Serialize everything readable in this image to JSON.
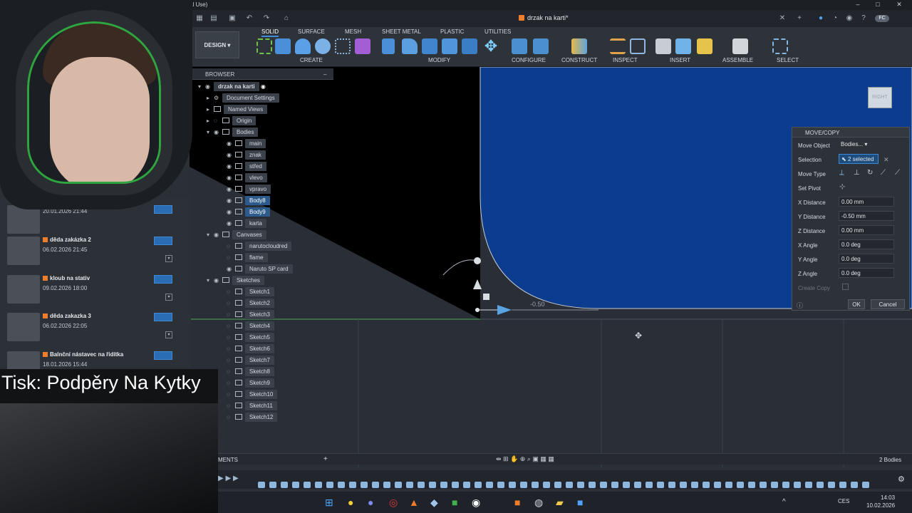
{
  "window": {
    "title": "al Use)"
  },
  "tab": {
    "doc_name": "drzak na karti*"
  },
  "toolbar": {
    "workspace": "DESIGN",
    "tabs": [
      "SOLID",
      "SURFACE",
      "MESH",
      "SHEET METAL",
      "PLASTIC",
      "UTILITIES"
    ],
    "groups": [
      "CREATE",
      "MODIFY",
      "CONFIGURE",
      "CONSTRUCT",
      "INSPECT",
      "INSERT",
      "ASSEMBLE",
      "SELECT"
    ]
  },
  "browser": {
    "header": "BROWSER",
    "root": "drzak na karti",
    "items": [
      "Document Settings",
      "Named Views",
      "Origin",
      "Bodies",
      "main",
      "znak",
      "střed",
      "vlevo",
      "vpravo",
      "Body8",
      "Body9",
      "karta",
      "Canvases",
      "narutocloudred",
      "flame",
      "Naruto SP card",
      "Sketches",
      "Sketch1",
      "Sketch2",
      "Sketch3",
      "Sketch4",
      "Sketch5",
      "Sketch6",
      "Sketch7",
      "Sketch8",
      "Sketch9",
      "Sketch10",
      "Sketch11",
      "Sketch12"
    ]
  },
  "projects": [
    {
      "name": "",
      "date": "20.01.2026 21:44"
    },
    {
      "name": "děda zakázka 2",
      "date": "06.02.2026 21:45"
    },
    {
      "name": "kloub na stativ",
      "date": "09.02.2026 18:00"
    },
    {
      "name": "děda zakazka 3",
      "date": "06.02.2026 22:05"
    },
    {
      "name": "Balnční nástavec na řidítka",
      "date": "18.01.2026 15:44"
    }
  ],
  "overlay": {
    "caption": "Tisk: Podpěry Na Kytky"
  },
  "viewcube": {
    "face": "RIGHT"
  },
  "canvas": {
    "dimension": "-0.50"
  },
  "dialog": {
    "title": "MOVE/COPY",
    "move_object_label": "Move Object",
    "move_object_value": "Bodies...",
    "selection_label": "Selection",
    "selection_value": "2 selected",
    "move_type_label": "Move Type",
    "set_pivot_label": "Set Pivot",
    "x_distance_label": "X Distance",
    "x_distance": "0.00 mm",
    "y_distance_label": "Y Distance",
    "y_distance": "-0.50 mm",
    "z_distance_label": "Z Distance",
    "z_distance": "0.00 mm",
    "x_angle_label": "X Angle",
    "x_angle": "0.0 deg",
    "y_angle_label": "Y Angle",
    "y_angle": "0.0 deg",
    "z_angle_label": "Z Angle",
    "z_angle": "0.0 deg",
    "create_copy_label": "Create Copy",
    "ok": "OK",
    "cancel": "Cancel"
  },
  "statusbar": {
    "comments": "MENTS",
    "bodies_count": "2 Bodies"
  },
  "taskbar": {
    "lang": "CES",
    "time": "14:03",
    "date": "10.02.2026"
  }
}
